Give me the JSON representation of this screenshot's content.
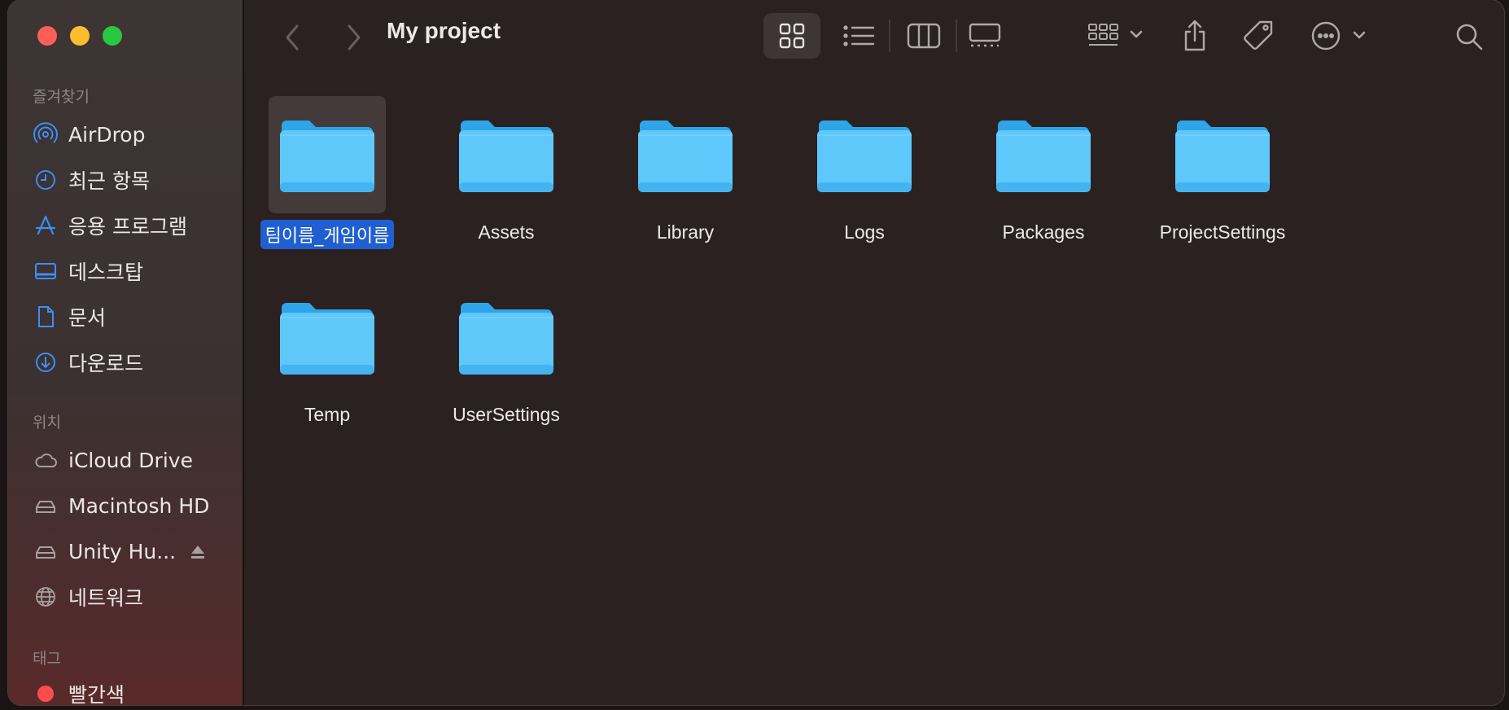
{
  "window": {
    "title": "My project"
  },
  "sidebar": {
    "favorites_label": "즐겨찾기",
    "favorites": [
      {
        "label": "AirDrop",
        "icon": "airdrop-icon"
      },
      {
        "label": "최근 항목",
        "icon": "clock-icon"
      },
      {
        "label": "응용 프로그램",
        "icon": "applications-icon"
      },
      {
        "label": "데스크탑",
        "icon": "desktop-icon"
      },
      {
        "label": "문서",
        "icon": "document-icon"
      },
      {
        "label": "다운로드",
        "icon": "download-icon"
      }
    ],
    "locations_label": "위치",
    "locations": [
      {
        "label": "iCloud Drive",
        "icon": "cloud-icon"
      },
      {
        "label": "Macintosh HD",
        "icon": "disk-icon"
      },
      {
        "label": "Unity Hu...",
        "icon": "disk-icon"
      },
      {
        "label": "네트워크",
        "icon": "network-icon"
      }
    ],
    "tags_label": "태그",
    "tags": [
      {
        "label": "빨간색",
        "color": "#ff4d4d"
      }
    ]
  },
  "toolbar": {
    "back": "chevron-left-icon",
    "forward": "chevron-right-icon",
    "views": [
      "icon-view",
      "list-view",
      "column-view",
      "gallery-view"
    ],
    "active_view": "icon-view",
    "group": "group-icon",
    "share": "share-icon",
    "tags": "tag-icon",
    "more": "more-icon",
    "search": "search-icon"
  },
  "items": [
    {
      "name": "팀이름_게임이름",
      "selected": true
    },
    {
      "name": "Assets"
    },
    {
      "name": "Library"
    },
    {
      "name": "Logs"
    },
    {
      "name": "Packages"
    },
    {
      "name": "ProjectSettings"
    },
    {
      "name": "Temp"
    },
    {
      "name": "UserSettings"
    }
  ],
  "colors": {
    "folder_light": "#5ec8fb",
    "folder_dark": "#2fa4e8",
    "selection": "#1f5fd1"
  }
}
